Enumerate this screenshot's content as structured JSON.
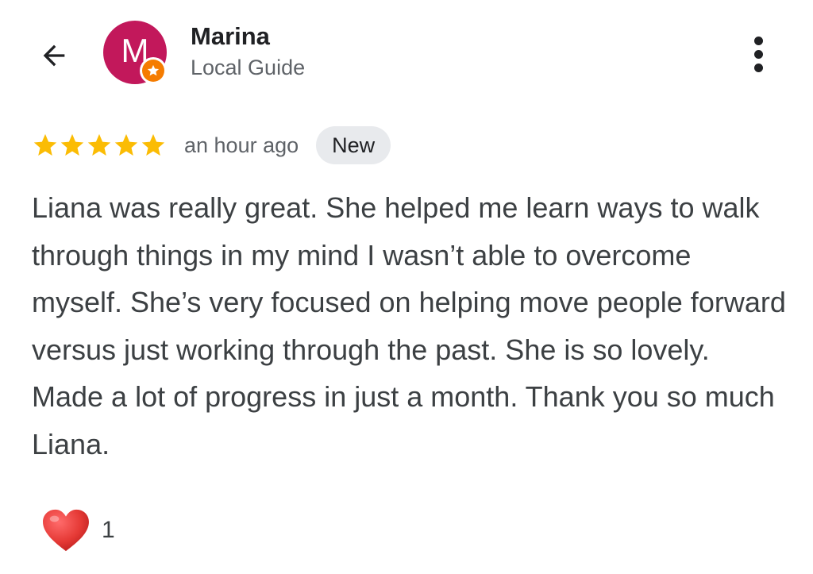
{
  "header": {
    "back_icon": "arrow-left-icon",
    "avatar_letter": "M",
    "avatar_color": "#c2185b",
    "badge_icon": "local-guide-star-icon",
    "badge_color": "#f57c00",
    "reviewer_name": "Marina",
    "reviewer_subtitle": "Local Guide",
    "more_icon": "more-vertical-icon"
  },
  "review": {
    "rating": 5,
    "max_rating": 5,
    "star_color": "#fbbc04",
    "time": "an hour ago",
    "badge": "New",
    "text": "Liana was really great. She helped me learn ways to walk through things in my mind I wasn’t able to overcome myself. She’s very focused on helping move people forward versus just working through the past. She is so lovely. Made a lot of progress in just a month. Thank you so much Liana."
  },
  "reactions": {
    "icon": "heart-icon",
    "heart_color": "#e53935",
    "count": "1"
  }
}
